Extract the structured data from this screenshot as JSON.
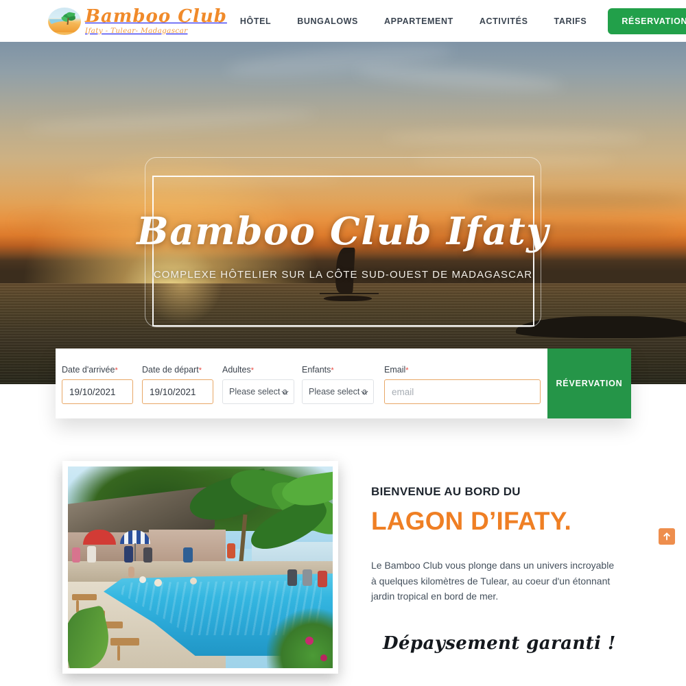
{
  "header": {
    "brand": {
      "name": "Bamboo Club",
      "tagline": "Ifaty - Tulear- Madagascar",
      "logo_icon": "palm-beach-logo-icon"
    },
    "nav_items": [
      {
        "label": "HÔTEL"
      },
      {
        "label": "BUNGALOWS"
      },
      {
        "label": "APPARTEMENT"
      },
      {
        "label": "ACTIVITÉS"
      },
      {
        "label": "TARIFS"
      }
    ],
    "cta_label": "RÉSERVATION",
    "cta_color": "#22a04a",
    "language_flag": "uk-flag-icon"
  },
  "hero": {
    "title": "Bamboo Club Ifaty",
    "subtitle": "COMPLEXE HÔTELIER SUR LA CÔTE SUD-OUEST DE MADAGASCAR",
    "image_description": "sunset-over-sea-with-pirogue-sailboat"
  },
  "booking_form": {
    "fields": [
      {
        "label": "Date d'arrivée",
        "required": "*",
        "value": "19/10/2021",
        "type": "date"
      },
      {
        "label": "Date de départ",
        "required": "*",
        "value": "19/10/2021",
        "type": "date"
      },
      {
        "label": "Adultes",
        "required": "*",
        "value": "Please select a",
        "type": "select"
      },
      {
        "label": "Enfants",
        "required": "*",
        "value": "Please select a",
        "type": "select"
      },
      {
        "label": "Email",
        "required": "*",
        "value": "",
        "placeholder": "email",
        "type": "email"
      }
    ],
    "submit_label": "RÉVERVATION",
    "submit_color": "#259548"
  },
  "welcome": {
    "kicker": "BIENVENUE AU BORD DU",
    "title": "LAGON D’IFATY.",
    "title_color": "#ef7f24",
    "body": "Le Bamboo Club vous plonge dans un univers incroyable à quelques kilomètres de Tulear, au coeur d'un étonnant jardin tropical en bord de mer.",
    "script_line": "Dépaysement garanti !",
    "photo_description": "swimming-pool-with-palm-trees-and-thatched-roof-bar"
  },
  "scroll_top": {
    "icon": "arrow-up-icon",
    "color": "#ee8e4d"
  }
}
